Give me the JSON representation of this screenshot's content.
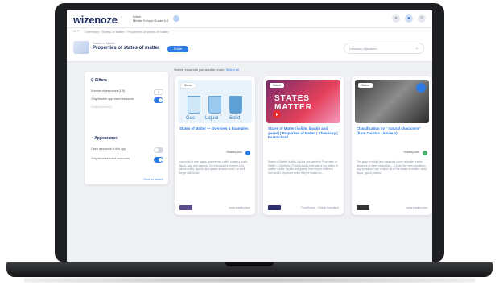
{
  "app": {
    "logo": "wizenoze",
    "school_line1": "Wiser",
    "school_line2": "Middle School Grade 6-8"
  },
  "breadcrumb": {
    "items": [
      "Chemistry",
      "States of Matter",
      "Properties of states of matter"
    ]
  },
  "lesson": {
    "super": "States of Matter",
    "title": "Properties of states of matter",
    "share_label": "Share"
  },
  "objectives": {
    "placeholder": "Learning objectives"
  },
  "select_hint": {
    "text": "Select resources you want to share.",
    "link": "Select all"
  },
  "filters": {
    "heading": "Filters",
    "rows": [
      {
        "label": "Number of resources (1-5)",
        "value": "3"
      },
      {
        "label": "Only teacher approved resources",
        "on": true
      },
      {
        "label": "Subject-focused",
        "on": false
      }
    ],
    "appearance_heading": "Appearance",
    "appearance_rows": [
      {
        "label": "Open resources in this app",
        "on": false
      },
      {
        "label": "Only show selected resources",
        "on": true
      }
    ],
    "reset_label": "Save as default"
  },
  "cards": [
    {
      "check_label": "Select",
      "title": "States of Matter — Overview & Examples",
      "source": "Readley.com",
      "description": "can exist in four states (sometimes called phases): solid, liquid, gas, and plasma. You've probably learned a lot about solids, liquids, and gases at some point, so we'll begin with those.",
      "url": "www.readley.com",
      "thumb_labels": [
        "Gas",
        "Liquid",
        "Solid"
      ]
    },
    {
      "check_label": "Select",
      "title": "States of Matter (solids, liquids and gases) | Properties of Matter | Chemistry | FuseSchool",
      "source": "",
      "description": "States of Matter (solids, liquids and gases) | Properties of Matter | Chemistry | FuseSchool Learn about the states of matter: solids, liquids and gases; how they're different, and what's important when they're heated to...",
      "url": "FuseSchool - Global Education",
      "thumb_text": "STATES MATTER"
    },
    {
      "check_label": "Select",
      "title": "Classification by \" natural characters\" (from Carolus Linnaeus)",
      "source": "Readley.com",
      "description": "The state in which any particular piece of matter exists depends on three properties.... Under the right conditions, any substance can exist in all of the states of matter: solid, liquid, gas or plasma.",
      "url": "www.readley.com"
    }
  ]
}
